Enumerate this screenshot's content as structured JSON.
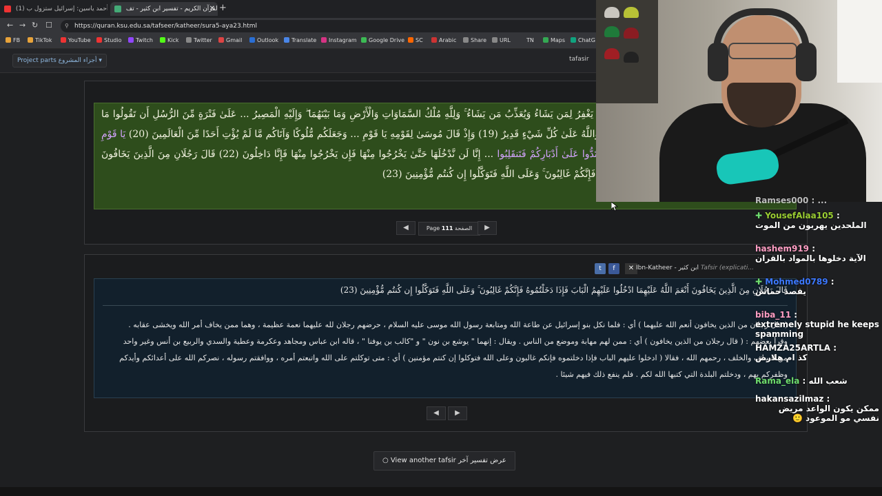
{
  "browser": {
    "tabs": [
      {
        "title": "(1) الشيخ أحمد ياسين: إسرائيل ستزول ب..."
      },
      {
        "title": "القرآن الكريم - تفسير ابن كثير - تف..."
      }
    ],
    "url": "https://quran.ksu.edu.sa/tafseer/katheer/sura5-aya23.html",
    "bookmarks": [
      "FB",
      "TikTok",
      "YouTube",
      "Studio",
      "Twitch",
      "Kick",
      "Twitter",
      "Gmail",
      "Outlook",
      "Translate",
      "Instagram",
      "Google Drive",
      "SC",
      "Arabic",
      "Share",
      "URL",
      "TN",
      "Maps",
      "ChatG"
    ]
  },
  "page": {
    "project_parts": "Project parts أجزاء المشروع",
    "tafsir_label": "tafasir",
    "verse_text_1": "قُلْ فَلِمَ يُعَذِّبُكُم بِذُنُوبِكُم ۖ بَلْ أَنتُم بَشَرٌ مِّمَّنْ خَلَقَ ۚ يَغْفِرُ لِمَن يَشَاءُ وَيُعَذِّبُ مَن يَشَاءُ ۚ وَلِلَّهِ مُلْكُ السَّمَاوَاتِ وَالْأَرْضِ وَمَا بَيْنَهُمَا ۖ وَإِلَيْهِ الْمَصِيرُ ... عَلَىٰ فَتْرَةٍ مِّنَ الرُّسُلِ أَن تَقُولُوا مَا جَاءَنَا مِن بَشِيرٍ وَلَا نَذِيرٍ ۖ فَقَدْ جَاءَكُم بَشِيرٌ وَنَذِيرٌ ۗ وَاللَّهُ عَلَىٰ كُلِّ شَيْءٍ قَدِيرٌ (19) وَإِذْ قَالَ مُوسَىٰ لِقَوْمِهِ يَا قَوْمِ ... وَجَعَلَكُم مُّلُوكًا وَآتَاكُم مَّا لَمْ يُؤْتِ أَحَدًا مِّنَ الْعَالَمِينَ (20)",
    "verse_text_hl": "يَا قَوْمِ ادْخُلُوا الْأَرْضَ الْمُقَدَّسَةَ الَّتِي كَتَبَ اللَّهُ لَكُمْ وَلَا تَرْتَدُّوا عَلَىٰ أَدْبَارِكُمْ فَتَنقَلِبُوا",
    "verse_text_2": "... إِنَّا لَن نَّدْخُلَهَا حَتَّىٰ يَخْرُجُوا مِنْهَا فَإِن يَخْرُجُوا مِنْهَا فَإِنَّا دَاخِلُونَ (22) قَالَ رَجُلَانِ مِنَ الَّذِينَ يَخَافُونَ أَنْعَمَ اللَّهُ عَلَيْهِمَا ادْخُلُوا عَلَيْهِمُ الْبَابَ فَإِذَا دَخَلْتُمُوهُ فَإِنَّكُمْ غَالِبُونَ ۚ وَعَلَى اللَّهِ فَتَوَكَّلُوا إِن كُنتُم مُّؤْمِنِينَ (23)",
    "page_label": "Page",
    "page_number": "111",
    "page_ar": "الصفحة",
    "tafsir_head": "Ibn-Katheer - ابن كثير",
    "tafsir_head_em": "Tafsir (explicati...",
    "tafsir_verse": "قَالَ رَجُلَانِ مِنَ الَّذِينَ يَخَافُونَ أَنْعَمَ اللَّهُ عَلَيْهِمَا ادْخُلُوا عَلَيْهِمُ الْبَابَ فَإِذَا دَخَلْتُمُوهُ فَإِنَّكُمْ غَالِبُونَ ۚ وَعَلَى اللَّهِ فَتَوَكَّلُوا إِن كُنتُم مُّؤْمِنِينَ (23)",
    "tafsir_body_1": "( قال رجلان من الذين يخافون أنعم الله عليهما ) أي : فلما نكل بنو إسرائيل عن طاعة الله ومتابعة رسول الله موسى عليه السلام ، حرضهم رجلان لله عليهما نعمة عظيمة ، وهما ممن يخاف أمر الله ويخشى عقابه .",
    "tafsir_body_2": "وقرأ بعضهم : ( قال رجلان من الذين يخافون ) أي : ممن لهم مهابة وموضع من الناس . ويقال : إنهما \" يوشع بن نون \" و \"كالب بن يوفنا \" ، قاله ابن عباس ومجاهد وعكرمة وعطية والسدي والربيع بن أنس وغير واحد",
    "tafsir_body_3": "من السلف والخلف ، رحمهم الله ، فقالا ( ادخلوا عليهم الباب فإذا دخلتموه فإنكم غالبون وعلى الله فتوكلوا إن كنتم مؤمنين ) أي : متى توكلتم على الله واتبعتم أمره ، ووافقتم رسوله ، نصركم الله على أعدائكم وأيدكم",
    "tafsir_body_4": "وظفركم بهم ، ودخلتم البلدة التي كتبها الله لكم . فلم ينفع ذلك فيهم شيئا .",
    "view_another": "View another tafsir عرض تفسير آخر"
  },
  "chat": [
    {
      "user": "Ramses000",
      "text": "...",
      "color": "#ffffff"
    },
    {
      "user": "YousefAlaa105",
      "text": "الملحدين يهربون من الموت",
      "color": "#9acd32"
    },
    {
      "user": "hashem919",
      "text": "الآية دخلوها بالمواد بالقران",
      "color": "#ff9ec4"
    },
    {
      "user": "Mohmed0789",
      "text": "يقصد حماس",
      "color": "#3c78ff"
    },
    {
      "user": "biba_11",
      "text": "extremely stupid he keeps spamming",
      "color": "#ff9ec4"
    },
    {
      "user": "HAMZA25ARTLA",
      "text": "كذ ام هلارض",
      "color": "#ffffff"
    },
    {
      "user": "Rama_ela",
      "text": "شعب الله",
      "color": "#6fdd6f"
    },
    {
      "user": "hakansazilmaz",
      "text": "ممكن يكون الواعد مريض نفسي مو الموعود 🙂",
      "color": "#ffffff"
    }
  ]
}
